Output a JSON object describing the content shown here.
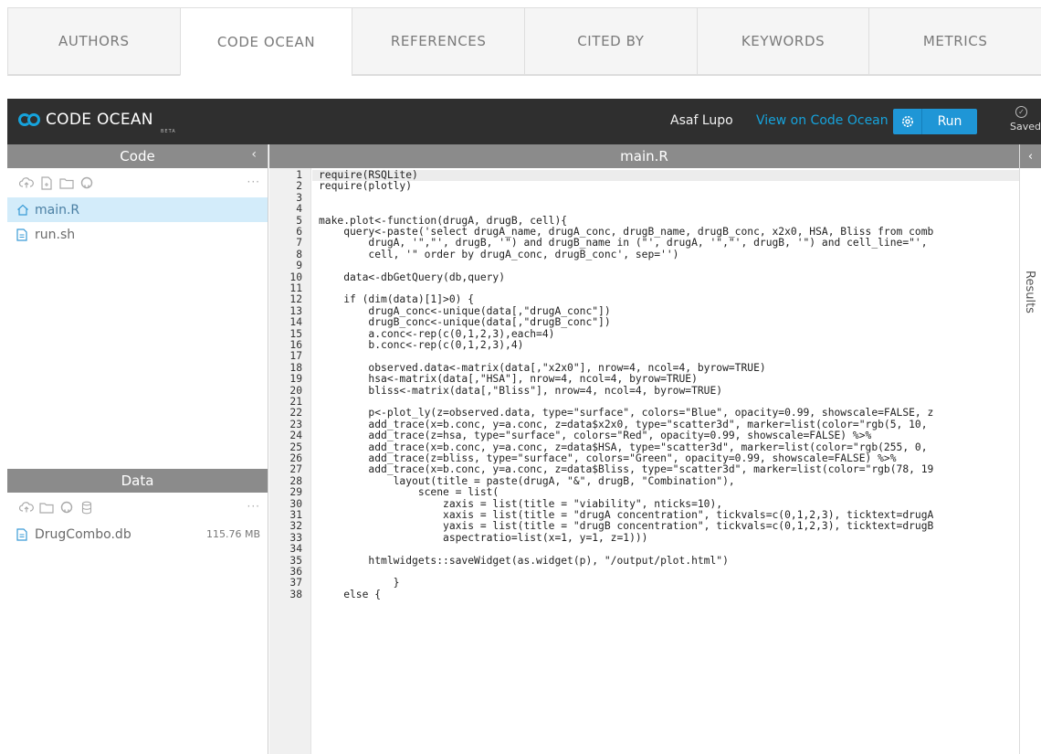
{
  "tabs": [
    {
      "label": "AUTHORS"
    },
    {
      "label": "CODE OCEAN"
    },
    {
      "label": "REFERENCES"
    },
    {
      "label": "CITED BY"
    },
    {
      "label": "KEYWORDS"
    },
    {
      "label": "METRICS"
    }
  ],
  "active_tab": "CODE OCEAN",
  "header": {
    "logo_text": "CODE OCEAN",
    "beta": "BETA",
    "user": "Asaf Lupo",
    "view_link": "View on Code Ocean",
    "run_label": "Run",
    "saved_label": "Saved"
  },
  "colors": {
    "accent": "#1f96d6",
    "topbar": "#2f2f2f",
    "panel_header": "#8b8b8b",
    "selected": "#d3ecfa"
  },
  "code_panel": {
    "title": "Code",
    "files": [
      {
        "name": "main.R",
        "icon": "home-icon",
        "selected": true
      },
      {
        "name": "run.sh",
        "icon": "file-icon",
        "selected": false
      }
    ]
  },
  "data_panel": {
    "title": "Data",
    "files": [
      {
        "name": "DrugCombo.db",
        "size": "115.76 MB",
        "icon": "file-icon"
      }
    ]
  },
  "editor": {
    "filename": "main.R",
    "lines": [
      {
        "n": "1",
        "text": "require(RSQLite)"
      },
      {
        "n": "2",
        "text": "require(plotly)"
      },
      {
        "n": "3",
        "text": ""
      },
      {
        "n": "4",
        "text": ""
      },
      {
        "n": "5",
        "text": "make.plot<-function(drugA, drugB, cell){"
      },
      {
        "n": "6",
        "text": "    query<-paste('select drugA_name, drugA_conc, drugB_name, drugB_conc, x2x0, HSA, Bliss from comb"
      },
      {
        "n": "7",
        "text": "        drugA, '\",\"', drugB, '\") and drugB_name in (\"', drugA, '\",\"', drugB, '\") and cell_line=\"',"
      },
      {
        "n": "8",
        "text": "        cell, '\" order by drugA_conc, drugB_conc', sep='')"
      },
      {
        "n": "9",
        "text": ""
      },
      {
        "n": "10",
        "text": "    data<-dbGetQuery(db,query)"
      },
      {
        "n": "11",
        "text": ""
      },
      {
        "n": "12",
        "text": "    if (dim(data)[1]>0) {"
      },
      {
        "n": "13",
        "text": "        drugA_conc<-unique(data[,\"drugA_conc\"])"
      },
      {
        "n": "14",
        "text": "        drugB_conc<-unique(data[,\"drugB_conc\"])"
      },
      {
        "n": "15",
        "text": "        a.conc<-rep(c(0,1,2,3),each=4)"
      },
      {
        "n": "16",
        "text": "        b.conc<-rep(c(0,1,2,3),4)"
      },
      {
        "n": "17",
        "text": ""
      },
      {
        "n": "18",
        "text": "        observed.data<-matrix(data[,\"x2x0\"], nrow=4, ncol=4, byrow=TRUE)"
      },
      {
        "n": "19",
        "text": "        hsa<-matrix(data[,\"HSA\"], nrow=4, ncol=4, byrow=TRUE)"
      },
      {
        "n": "20",
        "text": "        bliss<-matrix(data[,\"Bliss\"], nrow=4, ncol=4, byrow=TRUE)"
      },
      {
        "n": "21",
        "text": ""
      },
      {
        "n": "22",
        "text": "        p<-plot_ly(z=observed.data, type=\"surface\", colors=\"Blue\", opacity=0.99, showscale=FALSE, z"
      },
      {
        "n": "23",
        "text": "        add_trace(x=b.conc, y=a.conc, z=data$x2x0, type=\"scatter3d\", marker=list(color=\"rgb(5, 10,"
      },
      {
        "n": "24",
        "text": "        add_trace(z=hsa, type=\"surface\", colors=\"Red\", opacity=0.99, showscale=FALSE) %>%"
      },
      {
        "n": "25",
        "text": "        add_trace(x=b.conc, y=a.conc, z=data$HSA, type=\"scatter3d\", marker=list(color=\"rgb(255, 0,"
      },
      {
        "n": "26",
        "text": "        add_trace(z=bliss, type=\"surface\", colors=\"Green\", opacity=0.99, showscale=FALSE) %>%"
      },
      {
        "n": "27",
        "text": "        add_trace(x=b.conc, y=a.conc, z=data$Bliss, type=\"scatter3d\", marker=list(color=\"rgb(78, 19"
      },
      {
        "n": "28",
        "text": "            layout(title = paste(drugA, \"&\", drugB, \"Combination\"),"
      },
      {
        "n": "29",
        "text": "                scene = list("
      },
      {
        "n": "30",
        "text": "                    zaxis = list(title = \"viability\", nticks=10),"
      },
      {
        "n": "31",
        "text": "                    xaxis = list(title = \"drugA concentration\", tickvals=c(0,1,2,3), ticktext=drugA"
      },
      {
        "n": "32",
        "text": "                    yaxis = list(title = \"drugB concentration\", tickvals=c(0,1,2,3), ticktext=drugB"
      },
      {
        "n": "33",
        "text": "                    aspectratio=list(x=1, y=1, z=1)))"
      },
      {
        "n": "34",
        "text": ""
      },
      {
        "n": "35",
        "text": "        htmlwidgets::saveWidget(as.widget(p), \"/output/plot.html\")"
      },
      {
        "n": "36",
        "text": ""
      },
      {
        "n": "37",
        "text": "            }"
      },
      {
        "n": "38",
        "text": "    else {"
      }
    ]
  },
  "results_panel": {
    "label": "Results"
  }
}
